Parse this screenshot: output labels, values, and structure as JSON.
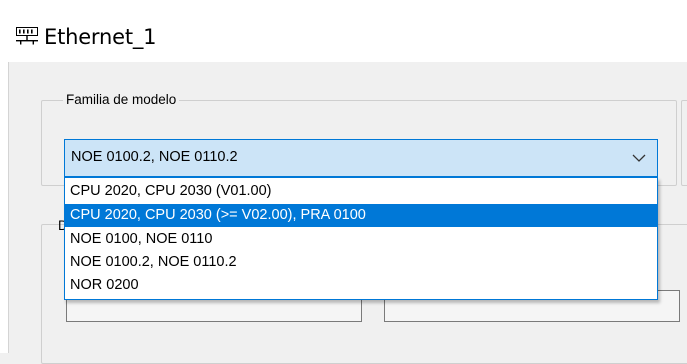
{
  "window": {
    "title": "Ethernet_1",
    "title_icon": "network-ports-icon"
  },
  "model_family": {
    "group_label": "Familia de modelo",
    "selected_value": "NOE 0100.2, NOE 0110.2",
    "options": [
      {
        "label": "CPU 2020, CPU 2030 (V01.00)",
        "highlighted": false
      },
      {
        "label": "CPU 2020, CPU 2030 (>= V02.00), PRA 0100",
        "highlighted": true
      },
      {
        "label": "NOE 0100, NOE 0110",
        "highlighted": false
      },
      {
        "label": "NOE 0100.2, NOE 0110.2",
        "highlighted": false
      },
      {
        "label": "NOR 0200",
        "highlighted": false
      }
    ]
  },
  "second_group": {
    "partial_label": "D"
  },
  "colors": {
    "accent": "#0078d7",
    "combo_bg": "#cce4f7",
    "dialog_bg": "#f0f0f0"
  }
}
